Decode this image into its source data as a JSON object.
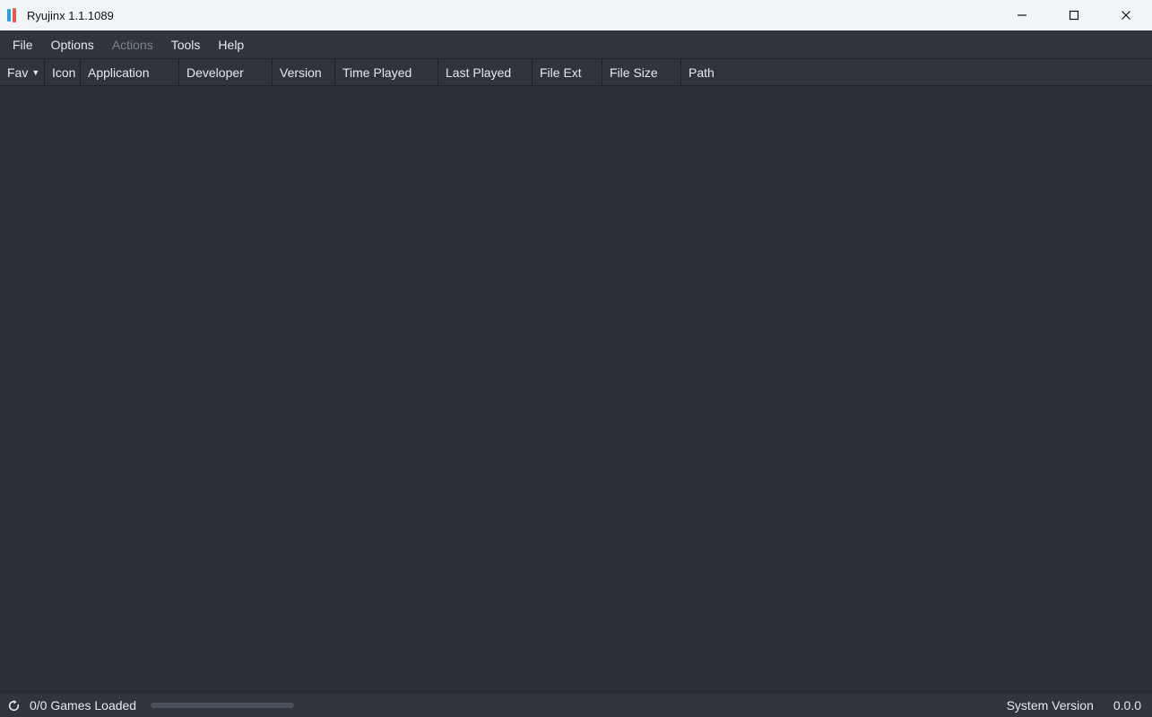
{
  "window": {
    "title": "Ryujinx 1.1.1089"
  },
  "menu": {
    "file": "File",
    "options": "Options",
    "actions": "Actions",
    "tools": "Tools",
    "help": "Help"
  },
  "columns": {
    "fav": "Fav",
    "icon": "Icon",
    "application": "Application",
    "developer": "Developer",
    "version": "Version",
    "time_played": "Time Played",
    "last_played": "Last Played",
    "file_ext": "File Ext",
    "file_size": "File Size",
    "path": "Path"
  },
  "status": {
    "games_loaded": "0/0 Games Loaded",
    "system_version_label": "System Version",
    "system_version_value": "0.0.0"
  }
}
